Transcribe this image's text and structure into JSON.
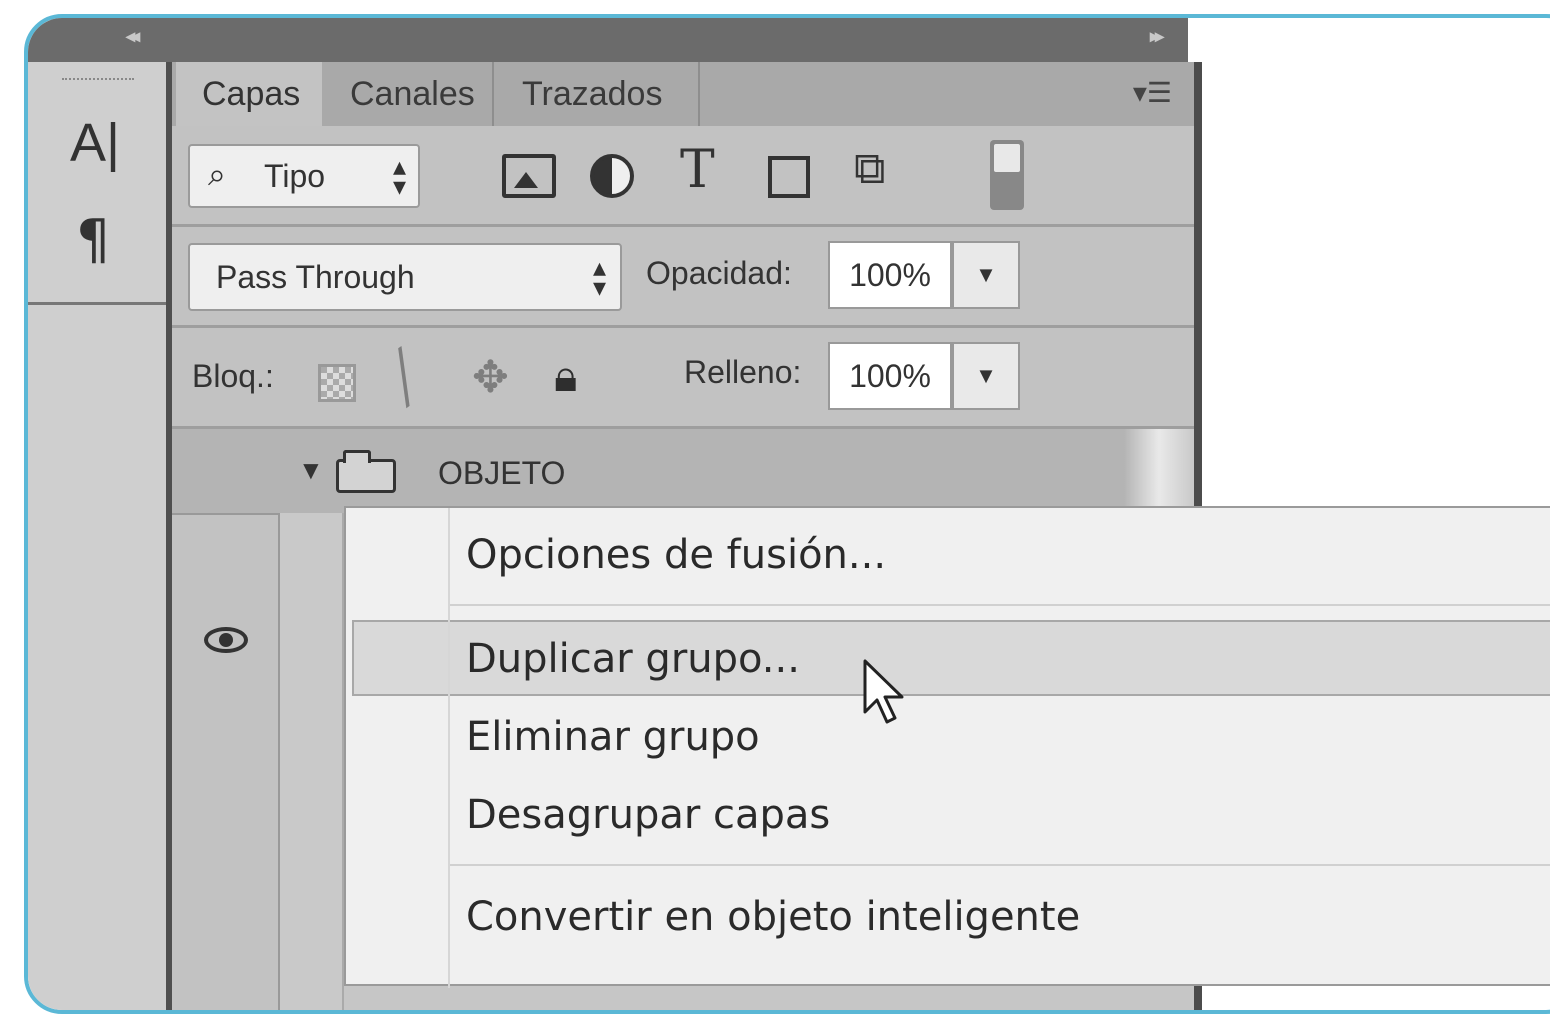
{
  "tabs": [
    "Capas",
    "Canales",
    "Trazados"
  ],
  "filter": {
    "label": "Tipo"
  },
  "blend_mode": "Pass Through",
  "opacity": {
    "label": "Opacidad:",
    "value": "100%"
  },
  "lock": {
    "label": "Bloq.:"
  },
  "fill": {
    "label": "Relleno:",
    "value": "100%"
  },
  "layers": [
    {
      "name": "OBJETO",
      "type": "group",
      "expanded": true
    }
  ],
  "context_menu": {
    "items": [
      "Opciones de fusión...",
      "Duplicar grupo...",
      "Eliminar grupo",
      "Desagrupar capas",
      "Convertir en objeto inteligente"
    ],
    "highlighted": "Duplicar grupo..."
  },
  "icons": {
    "tools": [
      "character-icon",
      "paragraph-icon"
    ],
    "filters": [
      "image-filter-icon",
      "adjustment-filter-icon",
      "type-filter-icon",
      "shape-filter-icon",
      "smart-object-filter-icon"
    ],
    "locks": [
      "lock-transparent-icon",
      "lock-brush-icon",
      "lock-position-icon",
      "lock-all-icon"
    ]
  },
  "colors": {
    "frame_border": "#5bb8d6",
    "menu_bg": "#f0f0f0",
    "highlight": "#d9d9d9"
  }
}
